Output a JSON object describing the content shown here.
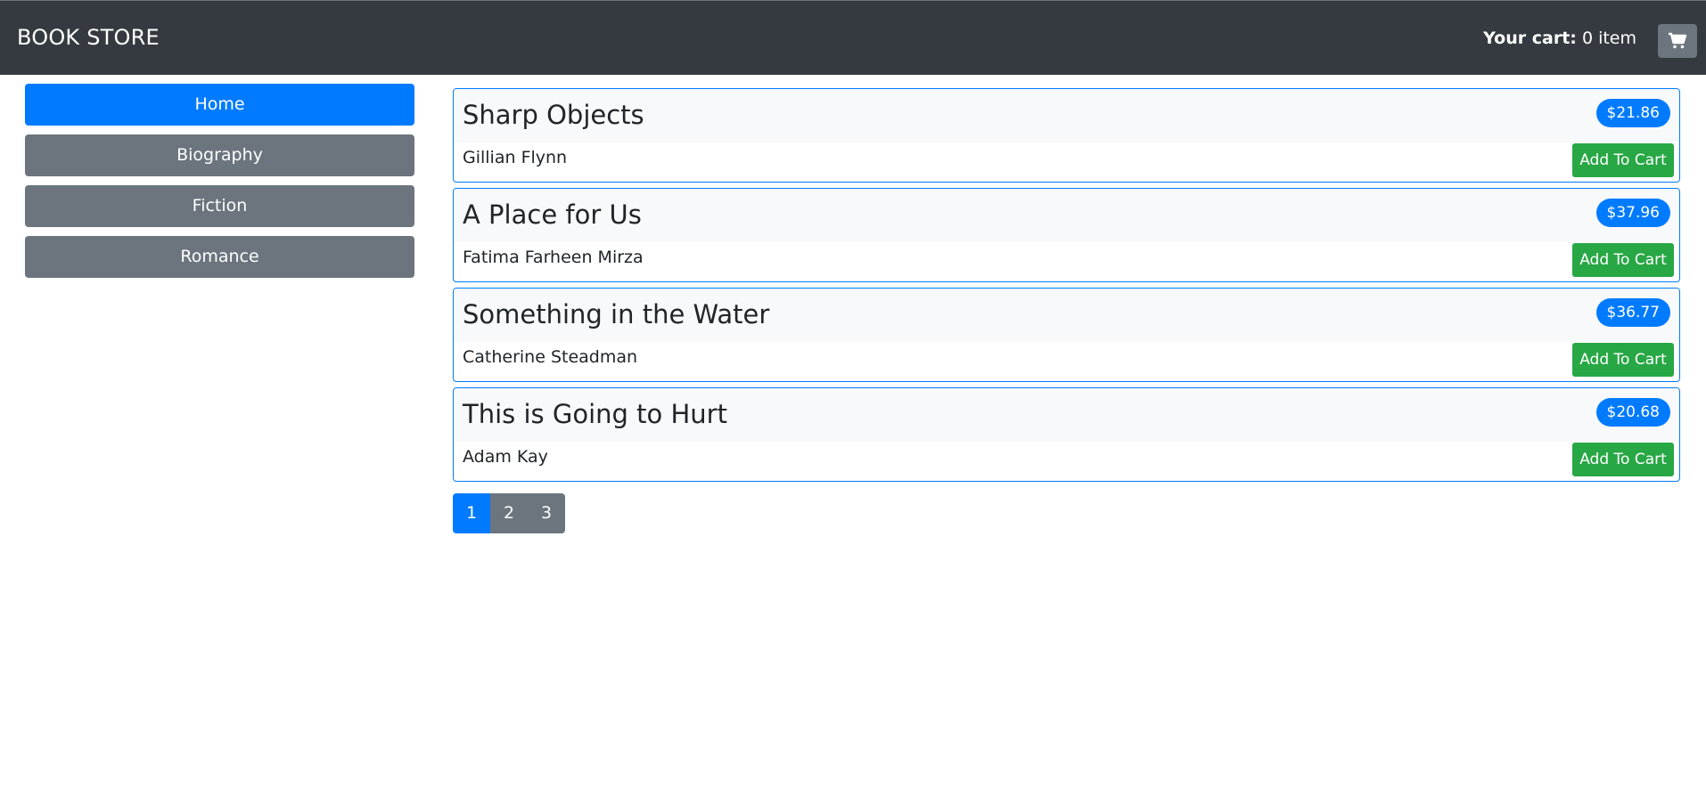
{
  "navbar": {
    "brand": "BOOK STORE",
    "cart_label": "Your cart:",
    "cart_count": "0 item",
    "cart_icon": "shopping-cart-icon"
  },
  "categories": [
    {
      "label": "Home",
      "active": true
    },
    {
      "label": "Biography",
      "active": false
    },
    {
      "label": "Fiction",
      "active": false
    },
    {
      "label": "Romance",
      "active": false
    }
  ],
  "books": [
    {
      "title": "Sharp Objects",
      "author": "Gillian Flynn",
      "price": "$21.86",
      "button": "Add To Cart"
    },
    {
      "title": "A Place for Us",
      "author": "Fatima Farheen Mirza",
      "price": "$37.96",
      "button": "Add To Cart"
    },
    {
      "title": "Something in the Water",
      "author": "Catherine Steadman",
      "price": "$36.77",
      "button": "Add To Cart"
    },
    {
      "title": "This is Going to Hurt",
      "author": "Adam Kay",
      "price": "$20.68",
      "button": "Add To Cart"
    }
  ],
  "pagination": {
    "pages": [
      "1",
      "2",
      "3"
    ],
    "current": "1"
  },
  "colors": {
    "navbar_bg": "#343a40",
    "primary": "#007bff",
    "secondary": "#6c757d",
    "success": "#28a745"
  }
}
